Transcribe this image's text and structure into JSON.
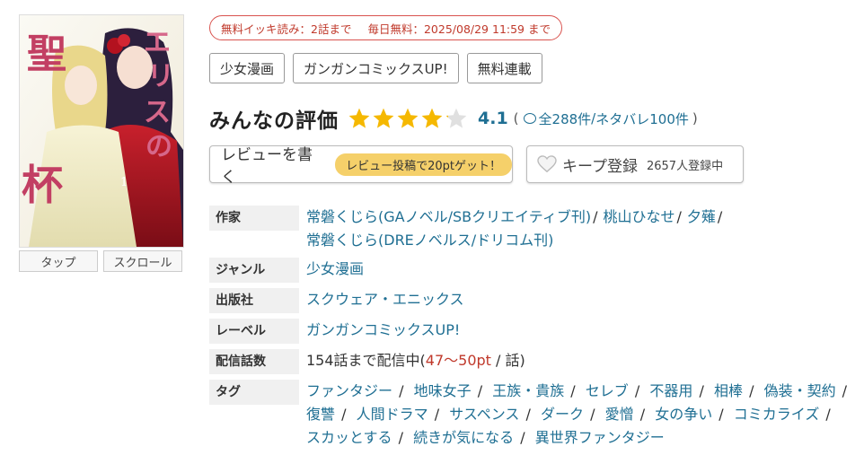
{
  "cover": {
    "title_chars": "聖エリスの杯"
  },
  "view_buttons": [
    "タップ",
    "スクロール"
  ],
  "free": {
    "label": "無料イッキ読み：2話まで",
    "daily": "毎日無料：2025/08/29 11:59 まで"
  },
  "tag_buttons": [
    "少女漫画",
    "ガンガンコミックスUP!",
    "無料連載"
  ],
  "rating": {
    "title": "みんなの評価",
    "score": "4.1",
    "stars_value": 4.1,
    "stars_max": 5,
    "open_paren": "(",
    "reviews": "全288件",
    "slash": "/",
    "spoilers": "ネタバレ100件",
    "close_paren": ")",
    "star_color": "#f5b800",
    "star_empty_color": "#e0e0e0"
  },
  "review_button": {
    "label": "レビューを書く",
    "promo": "レビュー投稿で20ptゲット！"
  },
  "keep_button": {
    "label": "キープ登録",
    "count": "2657人登録中"
  },
  "info": {
    "author_label": "作家",
    "authors": [
      "常磐くじら(GAノベル/SBクリエイティブ刊)",
      "桃山ひなせ",
      "夕薙",
      "常磐くじら(DREノベルス/ドリコム刊)"
    ],
    "genre_label": "ジャンル",
    "genre": "少女漫画",
    "publisher_label": "出版社",
    "publisher": "スクウェア・エニックス",
    "label_label": "レーベル",
    "label": "ガンガンコミックスUP!",
    "episodes_label": "配信話数",
    "episodes_prefix": "154話まで配信中(",
    "episodes_price": "47〜50pt",
    "episodes_suffix": " / 話)",
    "tags_label": "タグ",
    "tags": [
      "ファンタジー",
      "地味女子",
      "王族・貴族",
      "セレブ",
      "不器用",
      "相棒",
      "偽装・契約",
      "復讐",
      "人間ドラマ",
      "サスペンス",
      "ダーク",
      "愛憎",
      "女の争い",
      "コミカライズ",
      "スカッとする",
      "続きが気になる",
      "異世界ファンタジー"
    ]
  },
  "colors": {
    "link": "#1f6f93",
    "accent_red": "#c0392b",
    "promo_yellow": "#f5d06a"
  }
}
